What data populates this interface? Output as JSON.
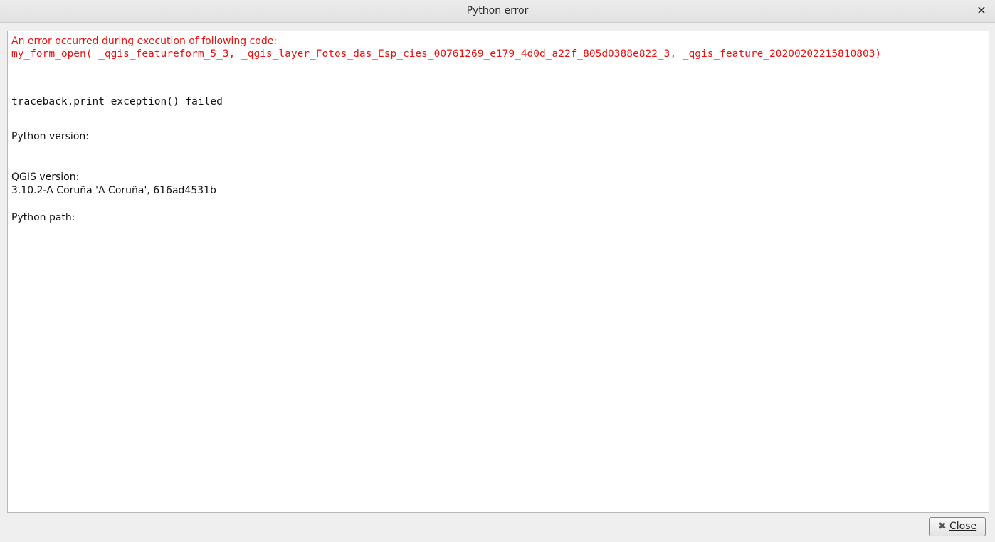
{
  "window": {
    "title": "Python error",
    "close_icon": "close-icon"
  },
  "error": {
    "heading": "An error occurred during execution of following code:",
    "code": "my_form_open( _qgis_featureform_5_3, _qgis_layer_Fotos_das_Esp_cies_00761269_e179_4d0d_a22f_805d0388e822_3, _qgis_feature_20200202215810803)",
    "traceback": "traceback.print_exception() failed"
  },
  "info": {
    "python_version_label": "Python version:",
    "qgis_version_label": "QGIS version:",
    "qgis_version_value": "3.10.2-A Coruña 'A Coruña', 616ad4531b",
    "python_path_label": "Python path:"
  },
  "footer": {
    "close_label": "Close",
    "close_icon": "close-x-icon"
  },
  "colors": {
    "error_text": "#e8110f",
    "button_border": "#5a8ec7"
  }
}
